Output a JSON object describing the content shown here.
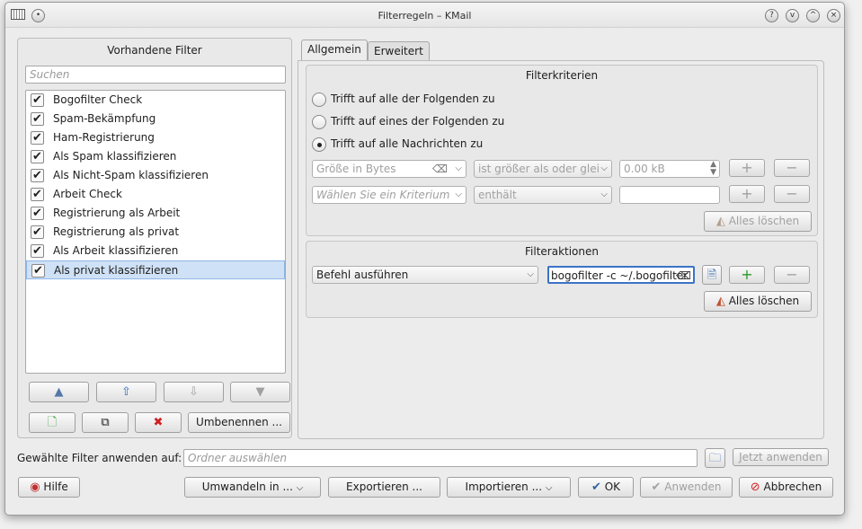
{
  "window": {
    "title": "Filterregeln – KMail",
    "controls": [
      "?",
      "v",
      "^",
      "×"
    ]
  },
  "left": {
    "header": "Vorhandene Filter",
    "search_placeholder": "Suchen",
    "filters": [
      {
        "label": "Bogofilter Check",
        "checked": true
      },
      {
        "label": "Spam-Bekämpfung",
        "checked": true
      },
      {
        "label": "Ham-Registrierung",
        "checked": true
      },
      {
        "label": "Als Spam klassifizieren",
        "checked": true
      },
      {
        "label": "Als Nicht-Spam klassifizieren",
        "checked": true
      },
      {
        "label": "Arbeit Check",
        "checked": true
      },
      {
        "label": "Registrierung als Arbeit",
        "checked": true
      },
      {
        "label": "Registrierung als privat",
        "checked": true
      },
      {
        "label": "Als Arbeit klassifizieren",
        "checked": true
      },
      {
        "label": "Als privat klassifizieren",
        "checked": true,
        "selected": true
      }
    ],
    "rename_label": "Umbenennen ..."
  },
  "tabs": [
    {
      "label": "Allgemein",
      "active": true
    },
    {
      "label": "Erweitert",
      "active": false
    }
  ],
  "criteria": {
    "header": "Filterkriterien",
    "radio_all": "Trifft auf alle der Folgenden zu",
    "radio_any": "Trifft auf eines der Folgenden zu",
    "radio_all_messages": "Trifft auf alle Nachrichten zu",
    "row1_field": "Größe in Bytes",
    "row1_op": "ist größer als oder glei",
    "row1_value": "0.00 kB",
    "row2_field_placeholder": "Wählen Sie ein Kriterium",
    "row2_op": "enthält",
    "clear_all": "Alles löschen"
  },
  "actions": {
    "header": "Filteraktionen",
    "action": "Befehl ausführen",
    "command": "bogofilter -c ~/.bogofilter",
    "clear_all": "Alles löschen"
  },
  "apply": {
    "label": "Gewählte Filter anwenden auf:",
    "folder_placeholder": "Ordner auswählen",
    "apply_now": "Jetzt anwenden"
  },
  "footer": {
    "help": "Hilfe",
    "convert": "Umwandeln in ...",
    "export": "Exportieren ...",
    "import": "Importieren ...",
    "ok": "OK",
    "apply": "Anwenden",
    "cancel": "Abbrechen"
  }
}
